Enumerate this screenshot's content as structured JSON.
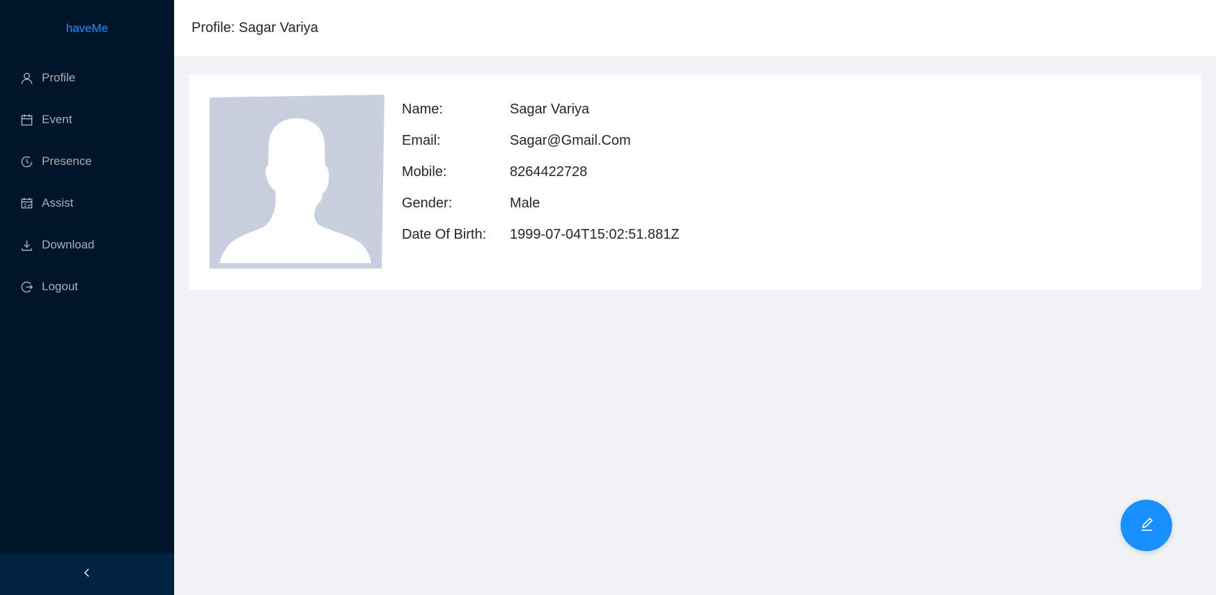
{
  "app": {
    "logo": "haveMe",
    "brand_color": "#1890ff",
    "sidebar_bg": "#001529"
  },
  "sidebar": {
    "items": [
      {
        "label": "Profile",
        "icon": "user-icon"
      },
      {
        "label": "Event",
        "icon": "calendar-icon"
      },
      {
        "label": "Presence",
        "icon": "clock-icon"
      },
      {
        "label": "Assist",
        "icon": "schedule-icon"
      },
      {
        "label": "Download",
        "icon": "download-icon"
      },
      {
        "label": "Logout",
        "icon": "logout-icon"
      }
    ],
    "collapse_icon": "chevron-left-icon"
  },
  "header": {
    "title": "Profile: Sagar Variya"
  },
  "profile": {
    "avatar_icon": "user-silhouette-icon",
    "fields": [
      {
        "label": "Name:",
        "value": "Sagar Variya"
      },
      {
        "label": "Email:",
        "value": "Sagar@Gmail.Com"
      },
      {
        "label": "Mobile:",
        "value": "8264422728"
      },
      {
        "label": "Gender:",
        "value": "Male"
      },
      {
        "label": "Date Of Birth:",
        "value": "1999-07-04T15:02:51.881Z"
      }
    ]
  },
  "fab": {
    "icon": "edit-icon"
  }
}
